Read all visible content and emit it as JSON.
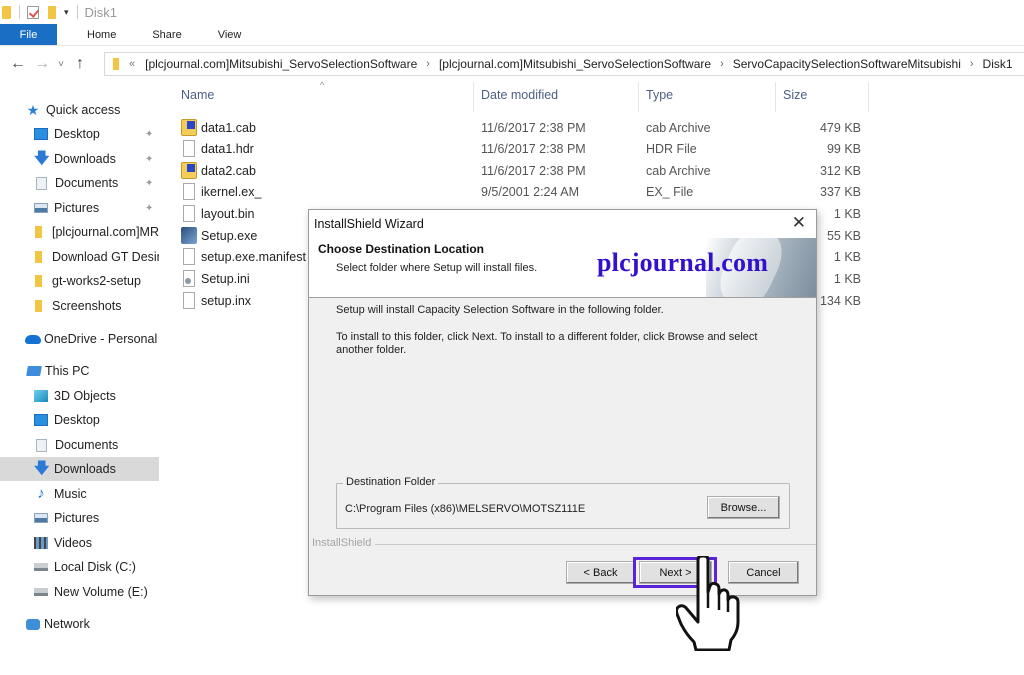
{
  "window": {
    "title": "Disk1"
  },
  "ribbon": {
    "tabs": [
      {
        "label": "File",
        "active": true
      },
      {
        "label": "Home"
      },
      {
        "label": "Share"
      },
      {
        "label": "View"
      }
    ],
    "accent_color": "#1a6fc4"
  },
  "navigation": {
    "back_icon": "←",
    "forward_icon": "→",
    "recent_icon": "˅",
    "up_icon": "↑",
    "overflow": "«",
    "separator": "›",
    "breadcrumbs": [
      "[plcjournal.com]Mitsubishi_ServoSelectionSoftware",
      "[plcjournal.com]Mitsubishi_ServoSelectionSoftware",
      "ServoCapacitySelectionSoftwareMitsubishi",
      "Disk1"
    ]
  },
  "sidebar": {
    "pin_glyph": "📌",
    "items": [
      {
        "label": "Quick access",
        "icon": "star-icon"
      },
      {
        "label": "Desktop",
        "icon": "desktop-icon",
        "pinned": true
      },
      {
        "label": "Downloads",
        "icon": "download-icon",
        "pinned": true
      },
      {
        "label": "Documents",
        "icon": "documents-icon",
        "pinned": true
      },
      {
        "label": "Pictures",
        "icon": "pictures-icon",
        "pinned": true
      },
      {
        "label": "[plcjournal.com]MR-",
        "icon": "folder-icon"
      },
      {
        "label": "Download GT Desin",
        "icon": "folder-icon"
      },
      {
        "label": "gt-works2-setup",
        "icon": "folder-icon"
      },
      {
        "label": "Screenshots",
        "icon": "folder-icon"
      },
      {
        "label": "OneDrive - Personal",
        "icon": "cloud-icon"
      },
      {
        "label": "This PC",
        "icon": "computer-icon"
      },
      {
        "label": "3D Objects",
        "icon": "3d-objects-icon"
      },
      {
        "label": "Desktop",
        "icon": "desktop-icon"
      },
      {
        "label": "Documents",
        "icon": "documents-icon"
      },
      {
        "label": "Downloads",
        "icon": "download-icon",
        "selected": true
      },
      {
        "label": "Music",
        "icon": "music-icon"
      },
      {
        "label": "Pictures",
        "icon": "pictures-icon"
      },
      {
        "label": "Videos",
        "icon": "videos-icon"
      },
      {
        "label": "Local Disk (C:)",
        "icon": "local-disk-icon"
      },
      {
        "label": "New Volume (E:)",
        "icon": "drive-icon"
      },
      {
        "label": "Network",
        "icon": "network-icon"
      }
    ]
  },
  "filelist": {
    "sort_indicator": "^",
    "columns": [
      "Name",
      "Date modified",
      "Type",
      "Size"
    ],
    "files": [
      {
        "name": "data1.cab",
        "date": "11/6/2017 2:38 PM",
        "type": "cab Archive",
        "size": "479 KB",
        "icon": "cab-archive-icon"
      },
      {
        "name": "data1.hdr",
        "date": "11/6/2017 2:38 PM",
        "type": "HDR File",
        "size": "99 KB",
        "icon": "file-icon"
      },
      {
        "name": "data2.cab",
        "date": "11/6/2017 2:38 PM",
        "type": "cab Archive",
        "size": "312 KB",
        "icon": "cab-archive-icon"
      },
      {
        "name": "ikernel.ex_",
        "date": "9/5/2001 2:24 AM",
        "type": "EX_ File",
        "size": "337 KB",
        "icon": "file-icon"
      },
      {
        "name": "layout.bin",
        "date": "",
        "type": "",
        "size": "1 KB",
        "icon": "file-icon"
      },
      {
        "name": "Setup.exe",
        "date": "",
        "type": "",
        "size": "55 KB",
        "icon": "setup-exe-icon"
      },
      {
        "name": "setup.exe.manifest",
        "date": "",
        "type": "",
        "size": "1 KB",
        "icon": "file-icon"
      },
      {
        "name": "Setup.ini",
        "date": "",
        "type": "",
        "size": "1 KB",
        "icon": "settings-file-icon"
      },
      {
        "name": "setup.inx",
        "date": "",
        "type": "",
        "size": "134 KB",
        "icon": "file-icon"
      }
    ]
  },
  "dialog": {
    "title": "InstallShield Wizard",
    "close_glyph": "✕",
    "heading": "Choose Destination Location",
    "subheading": "Select folder where Setup will install files.",
    "watermark": "plcjournal.com",
    "watermark_color": "#3311cc",
    "body_line1": "Setup will install Capacity Selection Software in the following folder.",
    "body_line2": "To install to this folder, click Next. To install to a different folder, click Browse and select another folder.",
    "destination_label": "Destination Folder",
    "destination_path": "C:\\Program Files (x86)\\MELSERVO\\MOTSZ111E",
    "browse_label": "Browse...",
    "brand": "InstallShield",
    "back_label": "< Back",
    "next_label": "Next >",
    "cancel_label": "Cancel",
    "highlight_color": "#5b22d6"
  }
}
